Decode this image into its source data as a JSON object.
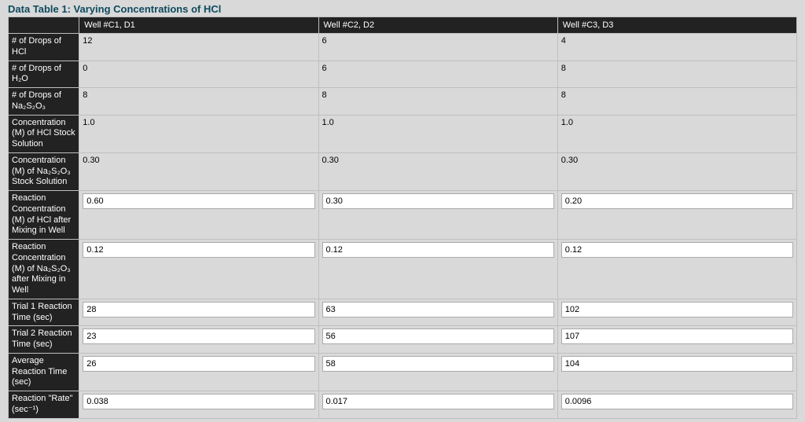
{
  "title": "Data Table 1: Varying Concentrations of HCl",
  "headers": {
    "blank": "",
    "c1": "Well #C1, D1",
    "c2": "Well #C2, D2",
    "c3": "Well #C3, D3"
  },
  "rows": {
    "dropsHCl": {
      "label": "# of Drops of HCl",
      "c1": "12",
      "c2": "6",
      "c3": "4",
      "input": false
    },
    "dropsH2O": {
      "label": "# of Drops of H₂O",
      "c1": "0",
      "c2": "6",
      "c3": "8",
      "input": false
    },
    "dropsThio": {
      "label": "# of Drops of Na₂S₂O₃",
      "c1": "8",
      "c2": "8",
      "c3": "8",
      "input": false
    },
    "concHClStk": {
      "label": "Concentration (M) of HCl Stock Solution",
      "c1": "1.0",
      "c2": "1.0",
      "c3": "1.0",
      "input": false
    },
    "concThioStk": {
      "label": "Concentration (M) of Na₂S₂O₃ Stock Solution",
      "c1": "0.30",
      "c2": "0.30",
      "c3": "0.30",
      "input": false
    },
    "rxnConcHCl": {
      "label": "Reaction Concentration (M) of HCl after Mixing in Well",
      "c1": "0.60",
      "c2": "0.30",
      "c3": "0.20",
      "input": true
    },
    "rxnConcThio": {
      "label": "Reaction Concentration (M) of Na₂S₂O₃ after Mixing in Well",
      "c1": "0.12",
      "c2": "0.12",
      "c3": "0.12",
      "input": true
    },
    "trial1": {
      "label": "Trial 1 Reaction Time (sec)",
      "c1": "28",
      "c2": "63",
      "c3": "102",
      "input": true
    },
    "trial2": {
      "label": "Trial 2 Reaction Time (sec)",
      "c1": "23",
      "c2": "56",
      "c3": "107",
      "input": true
    },
    "avg": {
      "label": "Average Reaction Time (sec)",
      "c1": "26",
      "c2": "58",
      "c3": "104",
      "input": true
    },
    "rate": {
      "label": "Reaction \"Rate\" (sec⁻¹)",
      "c1": "0.038",
      "c2": "0.017",
      "c3": "0.0096",
      "input": true
    }
  }
}
